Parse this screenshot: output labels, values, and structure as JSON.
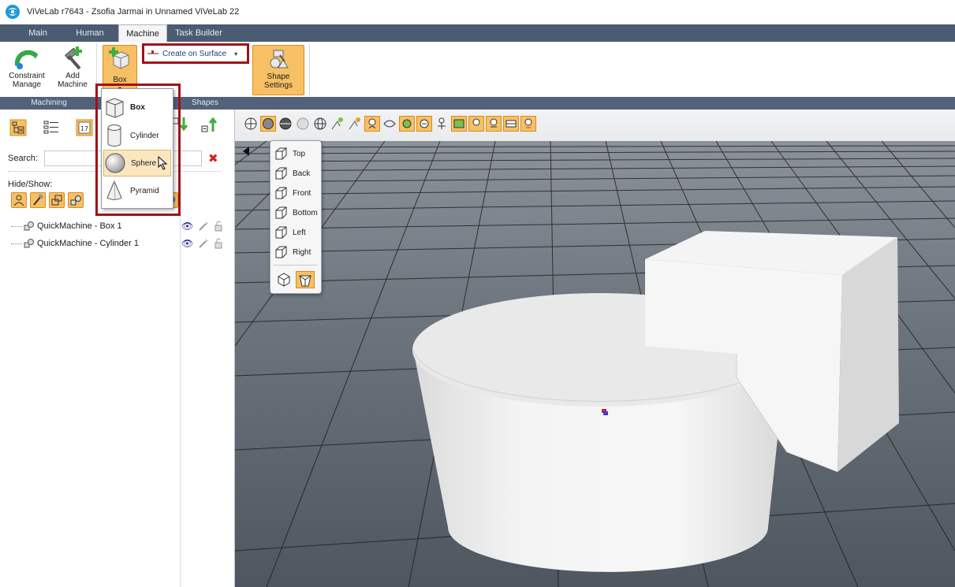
{
  "window": {
    "title": "ViVeLab r7643 - Zsofia Jarmai in Unnamed ViVeLab 22"
  },
  "tabs": [
    {
      "label": "Main"
    },
    {
      "label": "Human"
    },
    {
      "label": "Machine"
    },
    {
      "label": "Task Builder"
    }
  ],
  "ribbon": {
    "constraint_manage_label": "Constraint\nManage",
    "add_machine_label": "Add\nMachine",
    "box_label": "Box",
    "create_on_surface_label": "Create on Surface",
    "shape_settings_label": "Shape\nSettings",
    "groups": {
      "machining": "Machining",
      "shapes": "Shapes"
    }
  },
  "shape_menu": {
    "items": [
      {
        "label": "Box"
      },
      {
        "label": "Cylinder"
      },
      {
        "label": "Sphere"
      },
      {
        "label": "Pyramid"
      }
    ],
    "hovered": "Sphere"
  },
  "left_panel": {
    "search_label": "Search:",
    "search_value": "",
    "hide_show_label": "Hide/Show:",
    "tree": [
      {
        "label": "QuickMachine - Box 1"
      },
      {
        "label": "QuickMachine - Cylinder 1"
      }
    ]
  },
  "view_popup": {
    "items": [
      {
        "label": "Top"
      },
      {
        "label": "Back"
      },
      {
        "label": "Front"
      },
      {
        "label": "Bottom"
      },
      {
        "label": "Left"
      },
      {
        "label": "Right"
      }
    ]
  },
  "colors": {
    "tabbar": "#4a5b72",
    "highlight": "#a40f16",
    "orange_button": "#f8c064",
    "viewport_ground": "#5a6470"
  }
}
